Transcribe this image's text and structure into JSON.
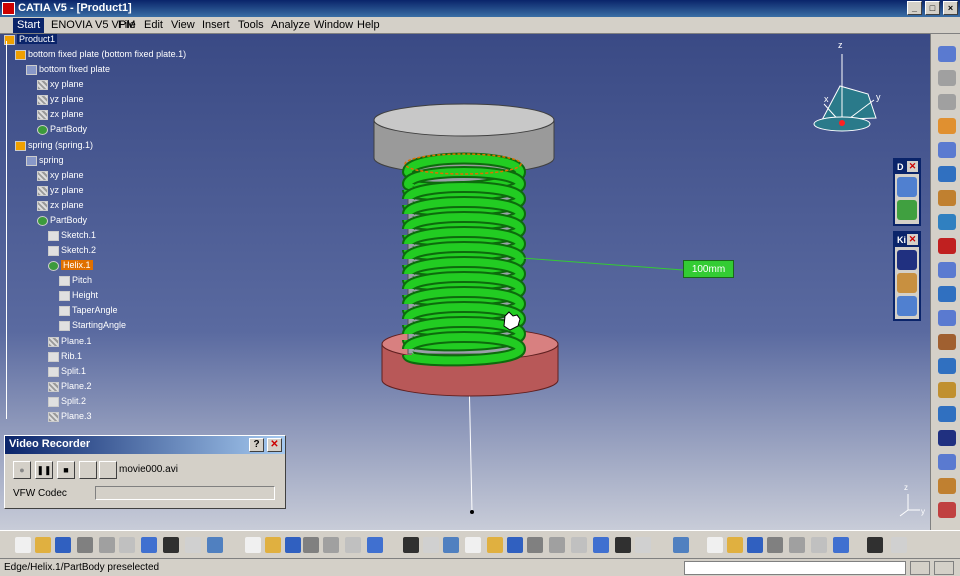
{
  "window": {
    "title": "CATIA V5 - [Product1]",
    "minimize_glyph": "_",
    "restore_glyph": "□",
    "close_glyph": "×"
  },
  "menu": {
    "items": [
      "Start",
      "ENOVIA V5 VPM",
      "File",
      "Edit",
      "View",
      "Insert",
      "Tools",
      "Analyze",
      "Window",
      "Help"
    ]
  },
  "tree": {
    "nodes": [
      {
        "label": "Product1",
        "icon": "product-icon",
        "state": "selected"
      },
      {
        "label": "bottom fixed plate (bottom fixed plate.1)",
        "icon": "part-instance-icon"
      },
      {
        "label": "bottom fixed plate",
        "icon": "part-icon"
      },
      {
        "label": "xy plane",
        "icon": "plane-icon"
      },
      {
        "label": "yz plane",
        "icon": "plane-icon"
      },
      {
        "label": "zx plane",
        "icon": "plane-icon"
      },
      {
        "label": "PartBody",
        "icon": "partbody-gear-icon"
      },
      {
        "label": "spring (spring.1)",
        "icon": "part-instance-icon"
      },
      {
        "label": "spring",
        "icon": "part-icon"
      },
      {
        "label": "xy plane",
        "icon": "plane-icon"
      },
      {
        "label": "yz plane",
        "icon": "plane-icon"
      },
      {
        "label": "zx plane",
        "icon": "plane-icon"
      },
      {
        "label": "PartBody",
        "icon": "partbody-gear-icon"
      },
      {
        "label": "Sketch.1",
        "icon": "sketch-icon"
      },
      {
        "label": "Sketch.2",
        "icon": "sketch-icon"
      },
      {
        "label": "Helix.1",
        "icon": "helix-icon",
        "state": "highlighted"
      },
      {
        "label": "Pitch",
        "icon": "parameter-icon"
      },
      {
        "label": "Height",
        "icon": "parameter-icon"
      },
      {
        "label": "TaperAngle",
        "icon": "parameter-icon"
      },
      {
        "label": "StartingAngle",
        "icon": "parameter-icon"
      },
      {
        "label": "Plane.1",
        "icon": "plane-icon"
      },
      {
        "label": "Rib.1",
        "icon": "rib-icon"
      },
      {
        "label": "Split.1",
        "icon": "split-icon"
      },
      {
        "label": "Plane.2",
        "icon": "plane-icon"
      },
      {
        "label": "Split.2",
        "icon": "split-icon"
      },
      {
        "label": "Plane.3",
        "icon": "plane-icon"
      }
    ]
  },
  "recorder": {
    "title": "Video Recorder",
    "help_glyph": "?",
    "close_glyph": "✕",
    "record_glyph": "●",
    "pause_glyph": "❚❚",
    "stop_glyph": "■",
    "filename": "movie000.avi",
    "codec_label": "VFW Codec",
    "codec_value": ""
  },
  "viewport": {
    "dimension_label": "100mm"
  },
  "palettes": [
    {
      "title": "D",
      "close": "✕"
    },
    {
      "title": "Ki",
      "close": "✕"
    }
  ],
  "compass": {
    "x_label": "x",
    "y_label": "y",
    "z_label": "z"
  },
  "status": {
    "text": "Edge/Helix.1/PartBody preselected",
    "command": ""
  },
  "colors": {
    "spring": "#22cc22",
    "top_plate": "#a8a8a8",
    "bottom_plate": "#c86464",
    "background_top": "#3a4a85",
    "background_bottom": "#c8ccd8",
    "selection": "#e07000"
  }
}
